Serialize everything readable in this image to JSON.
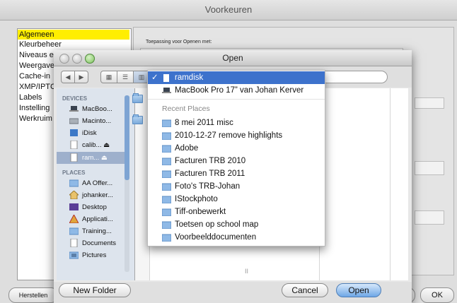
{
  "prefs": {
    "title": "Voorkeuren",
    "categories": [
      "Algemeen",
      "Kleurbeheer",
      "Niveaus e",
      "Weergave",
      "Cache-in",
      "XMP/IPTC",
      "Labels",
      "Instelling",
      "Werkruim"
    ],
    "panel_label": "Toepassing voor Openen met:",
    "reset_button": "Herstellen",
    "ok_button": "OK",
    "partial_button": "ren",
    "accent_color": "#ffee00"
  },
  "open_dialog": {
    "title": "Open",
    "view_icons": [
      "icon-view-icon",
      "list-view-icon",
      "column-view-icon"
    ],
    "sidebar": {
      "devices_header": "DEVICES",
      "devices": [
        {
          "label": "MacBoo...",
          "icon": "laptop-icon"
        },
        {
          "label": "Macinto...",
          "icon": "harddisk-icon"
        },
        {
          "label": "iDisk",
          "icon": "idisk-icon"
        },
        {
          "label": "calib... ⏏",
          "icon": "disk-icon"
        },
        {
          "label": "ram... ⏏",
          "icon": "disk-icon",
          "selected": true
        }
      ],
      "places_header": "PLACES",
      "places": [
        {
          "label": "AA Offer...",
          "icon": "folder-icon"
        },
        {
          "label": "johanker...",
          "icon": "home-icon"
        },
        {
          "label": "Desktop",
          "icon": "desktop-icon"
        },
        {
          "label": "Applicati...",
          "icon": "applications-icon"
        },
        {
          "label": "Training...",
          "icon": "folder-icon"
        },
        {
          "label": "Documents",
          "icon": "documents-icon"
        },
        {
          "label": "Pictures",
          "icon": "pictures-icon"
        }
      ]
    },
    "new_folder_button": "New Folder",
    "cancel_button": "Cancel",
    "open_button": "Open",
    "pane_marker": "II"
  },
  "location_menu": {
    "items": [
      {
        "label": "ramdisk",
        "checked": true,
        "icon": "disk-icon"
      },
      {
        "label": "MacBook Pro 17” van Johan Kerver",
        "icon": "laptop-icon"
      }
    ],
    "recent_header": "Recent Places",
    "recent": [
      "8 mei 2011 misc",
      "2010-12-27 remove highlights",
      "Adobe",
      "Facturen TRB 2010",
      "Facturen TRB 2011",
      "Foto's TRB-Johan",
      "IStockphoto",
      "Tiff-onbewerkt",
      "Toetsen op school map",
      "Voorbeelddocumenten"
    ],
    "selection_color": "#3d72cc"
  }
}
